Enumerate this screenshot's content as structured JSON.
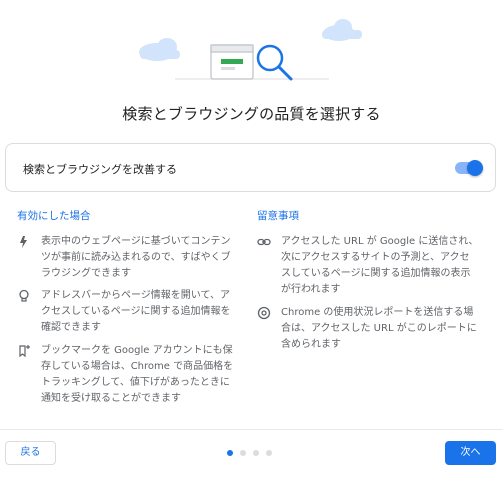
{
  "title": "検索とブラウジングの品質を選択する",
  "toggle": {
    "label": "検索とブラウジングを改善する",
    "on": true
  },
  "enabled": {
    "heading": "有効にした場合",
    "items": [
      {
        "icon": "lightning-icon",
        "text": "表示中のウェブページに基づいてコンテン\nツが事前に読み込まれるので、すばやくブ\nラウジングできます"
      },
      {
        "icon": "lightbulb-icon",
        "text": "アドレスバーからページ情報を開いて、ア\nクセスしているページに関する追加情報を\n確認できます"
      },
      {
        "icon": "bookmark-add-icon",
        "text": "ブックマークを Google アカウントにも保\n存している場合は、Chrome で商品価格を\nトラッキングして、値下げがあったときに\n通知を受け取ることができます"
      }
    ]
  },
  "notes": {
    "heading": "留意事項",
    "items": [
      {
        "icon": "link-icon",
        "text": "アクセスした URL が Google に送信され、\n次にアクセスするサイトの予測と、アクセ\nスしているページに関する追加情報の表示\nが行われます"
      },
      {
        "icon": "chrome-icon",
        "text": "Chrome の使用状況レポートを送信する場\n合は、アクセスした URL がこのレポートに\n含められます"
      }
    ]
  },
  "footer": {
    "back_label": "戻る",
    "next_label": "次へ",
    "page_dots": 4,
    "active_dot": 1
  },
  "colors": {
    "accent": "#1a73e8",
    "muted": "#5f6368"
  }
}
